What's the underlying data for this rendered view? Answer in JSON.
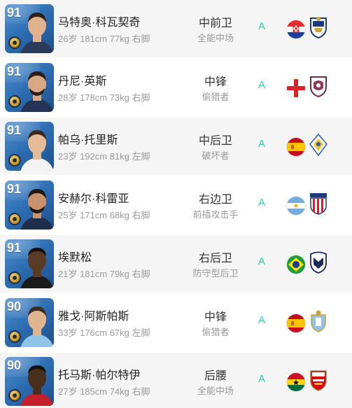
{
  "players": [
    {
      "rating": "91",
      "name": "马特奥·科瓦契奇",
      "meta": "26岁 181cm 77kg 右脚",
      "position": "中前卫",
      "role": "全能中场",
      "grade": "A",
      "flag_icon": "croatia-flag-icon",
      "club_icon": "club-crest-icon",
      "skin": "#e0b28e",
      "hair": "#2b2019"
    },
    {
      "rating": "91",
      "name": "丹尼·英斯",
      "meta": "28岁 178cm 73kg 右脚",
      "position": "中锋",
      "role": "偷猎者",
      "grade": "A",
      "flag_icon": "england-flag-icon",
      "club_icon": "club-crest-icon",
      "skin": "#d8a885",
      "hair": "#2a1f18"
    },
    {
      "rating": "91",
      "name": "帕乌·托里斯",
      "meta": "23岁 192cm 81kg 左脚",
      "position": "中后卫",
      "role": "破坏者",
      "grade": "A",
      "flag_icon": "spain-flag-icon",
      "club_icon": "club-crest-icon",
      "skin": "#e6bc98",
      "hair": "#3a2a1e"
    },
    {
      "rating": "91",
      "name": "安赫尔·科雷亚",
      "meta": "25岁 171cm 68kg 右脚",
      "position": "右边卫",
      "role": "前插攻击手",
      "grade": "A",
      "flag_icon": "argentina-flag-icon",
      "club_icon": "club-crest-icon",
      "skin": "#c9926a",
      "hair": "#1e1712"
    },
    {
      "rating": "91",
      "name": "埃默松",
      "meta": "21岁 181cm 79kg 右脚",
      "position": "右后卫",
      "role": "防守型后卫",
      "grade": "A",
      "flag_icon": "brazil-flag-icon",
      "club_icon": "club-crest-icon",
      "skin": "#5b3a26",
      "hair": "#141010"
    },
    {
      "rating": "90",
      "name": "雅戈·阿斯帕斯",
      "meta": "33岁 176cm 67kg 左脚",
      "position": "中锋",
      "role": "偷猎者",
      "grade": "A",
      "flag_icon": "spain-flag-icon",
      "club_icon": "club-crest-icon",
      "skin": "#e2b591",
      "hair": "#3b2b20"
    },
    {
      "rating": "90",
      "name": "托马斯·帕尔特伊",
      "meta": "27岁 185cm 74kg 右脚",
      "position": "后腰",
      "role": "全能中场",
      "grade": "A",
      "flag_icon": "ghana-flag-icon",
      "club_icon": "club-crest-icon",
      "skin": "#4a2e1e",
      "hair": "#111111"
    }
  ],
  "colors": {
    "grade": "#2ecfa6",
    "card": "#2f6fb4",
    "row_alt": "#f5f5f5"
  }
}
